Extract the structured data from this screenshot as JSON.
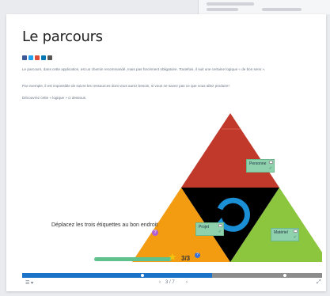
{
  "page": {
    "title": "Le parcours",
    "paragraphs": [
      "Le parcours, dans cette application, est un chemin recommandé, mais pas forcément obligatoire. Toutefois, il suit une certaine logique « de bon sens ».",
      "Par exemple, il est impossible de suivre les ressources dont vous aurez besoin, si vous ne savez pas ce que vous allez produire!",
      "Découvrez cette « logique » ci dessous."
    ]
  },
  "social": {
    "icons": [
      "facebook-icon",
      "twitter-icon",
      "googleplus-icon",
      "linkedin-icon",
      "email-icon"
    ],
    "colors": [
      "#3b5998",
      "#1da1f2",
      "#dd4b39",
      "#0077b5",
      "#555555"
    ]
  },
  "activity": {
    "instruction": "Déplacez les trois étiquettes au bon endroit",
    "help": "?",
    "score": "3/3",
    "score_info": "?",
    "tags": {
      "top": "Personne",
      "left": "Projet",
      "right": "Matériel"
    },
    "colors": {
      "top": "#c0392b",
      "left": "#f39c12",
      "right": "#8cc63f",
      "center": "#000000",
      "cycle": "#1b8fd6"
    }
  },
  "player": {
    "progress_done": 0.6,
    "page_indicator": "3 / 7",
    "prev_glyph": "‹",
    "next_glyph": "›",
    "menu_glyph": "☰ ▾",
    "fullscreen_glyph": "⤢"
  }
}
